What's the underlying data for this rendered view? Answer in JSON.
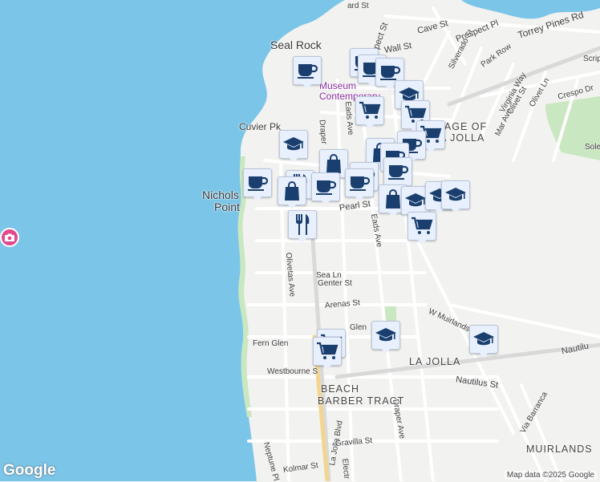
{
  "map": {
    "colors": {
      "water": "#7bc5e8",
      "land": "#f2f2f0",
      "park": "#c9e7c0",
      "road": "#ffffff",
      "beach": "#f8edc4",
      "highway": "#d8d8d8"
    },
    "place_labels": [
      {
        "id": "seal-rock",
        "text": "Seal Rock"
      },
      {
        "id": "nicholson-point",
        "lines": [
          "Nichols",
          "Point"
        ]
      },
      {
        "id": "cuvier-pk",
        "text": "Cuvier Pk"
      },
      {
        "id": "museum",
        "lines": [
          "Museum",
          "Contemporary"
        ]
      },
      {
        "id": "village",
        "lines": [
          "LLAGE OF",
          "A JOLLA"
        ]
      },
      {
        "id": "la-jolla",
        "text": "LA JOLLA"
      },
      {
        "id": "beach-barber",
        "lines": [
          "BEACH",
          "BARBER TRACT"
        ]
      },
      {
        "id": "muirlands",
        "text": "MUIRLANDS"
      }
    ],
    "street_labels": [
      {
        "id": "prospect-st",
        "text": "Prospect St"
      },
      {
        "id": "prospect-pl",
        "text": "Prospect Pl"
      },
      {
        "id": "torrey-pines-rd",
        "text": "Torrey Pines Rd"
      },
      {
        "id": "cave-st",
        "text": "Cave St"
      },
      {
        "id": "wall-st",
        "text": "Wall St"
      },
      {
        "id": "silverado-st",
        "text": "Silverado St"
      },
      {
        "id": "park-row",
        "text": "Park Row"
      },
      {
        "id": "virginia-way",
        "text": "Virginia Way"
      },
      {
        "id": "olivet-st",
        "text": "Olivet St"
      },
      {
        "id": "olivet-ln",
        "text": "Olivet Ln"
      },
      {
        "id": "crespo-dr",
        "text": "Crespo Dr"
      },
      {
        "id": "mar-ave",
        "text": "Mar Ave"
      },
      {
        "id": "eads-ave-1",
        "text": "Eads Ave"
      },
      {
        "id": "draper",
        "text": "Draper"
      },
      {
        "id": "pearl-st",
        "text": "Pearl St"
      },
      {
        "id": "eads-ave-2",
        "text": "Eads Ave"
      },
      {
        "id": "olivetas-ave",
        "text": "Olivetas Ave"
      },
      {
        "id": "sea-ln",
        "text": "Sea Ln"
      },
      {
        "id": "genter-st",
        "text": "Genter St"
      },
      {
        "id": "arenas-st",
        "text": "Arenas St"
      },
      {
        "id": "w-muirlands",
        "text": "W Muirlands"
      },
      {
        "id": "fern-glen",
        "text": "Fern Glen"
      },
      {
        "id": "glen",
        "text": "Glen"
      },
      {
        "id": "westbourne",
        "text": "Westbourne S"
      },
      {
        "id": "nautilus-st",
        "text": "Nautilus St"
      },
      {
        "id": "nautilu",
        "text": "Nautilu"
      },
      {
        "id": "draper-ave",
        "text": "Draper Ave"
      },
      {
        "id": "la-jolla-blvd",
        "text": "La Jolla Blvd"
      },
      {
        "id": "gravilla-st",
        "text": "Gravilla St"
      },
      {
        "id": "kolmar-st",
        "text": "Kolmar St"
      },
      {
        "id": "neptune-pl",
        "text": "Neptune Pl"
      },
      {
        "id": "electr",
        "text": "Electr"
      },
      {
        "id": "via-barranca",
        "text": "Via Barranca"
      },
      {
        "id": "torrey-pines-sole",
        "text": "Sole"
      },
      {
        "id": "scripps",
        "text": "Scripps"
      },
      {
        "id": "ard-st",
        "text": "ard St"
      }
    ],
    "markers": [
      {
        "icon": "coffee-cup"
      },
      {
        "icon": "coffee-cup"
      },
      {
        "icon": "coffee-cup"
      },
      {
        "icon": "coffee-cup"
      },
      {
        "icon": "graduation-cap"
      },
      {
        "icon": "shopping-cart"
      },
      {
        "icon": "shopping-cart"
      },
      {
        "icon": "shopping-cart"
      },
      {
        "icon": "graduation-cap"
      },
      {
        "icon": "coffee-cup"
      },
      {
        "icon": "shopping-bag"
      },
      {
        "icon": "shopping-bag"
      },
      {
        "icon": "coffee-cup"
      },
      {
        "icon": "coffee-cup"
      },
      {
        "icon": "coffee-cup"
      },
      {
        "icon": "utensils"
      },
      {
        "icon": "shopping-bag"
      },
      {
        "icon": "coffee-cup"
      },
      {
        "icon": "coffee-cup"
      },
      {
        "icon": "coffee-cup"
      },
      {
        "icon": "shopping-bag"
      },
      {
        "icon": "graduation-cap"
      },
      {
        "icon": "graduation-cap"
      },
      {
        "icon": "graduation-cap"
      },
      {
        "icon": "shopping-cart"
      },
      {
        "icon": "utensils"
      },
      {
        "icon": "shopping-cart"
      },
      {
        "icon": "shopping-cart"
      },
      {
        "icon": "graduation-cap"
      },
      {
        "icon": "graduation-cap"
      },
      {
        "icon": "camera"
      }
    ]
  },
  "footer": {
    "logo": "Google",
    "attribution": "Map data ©2025 Google"
  }
}
